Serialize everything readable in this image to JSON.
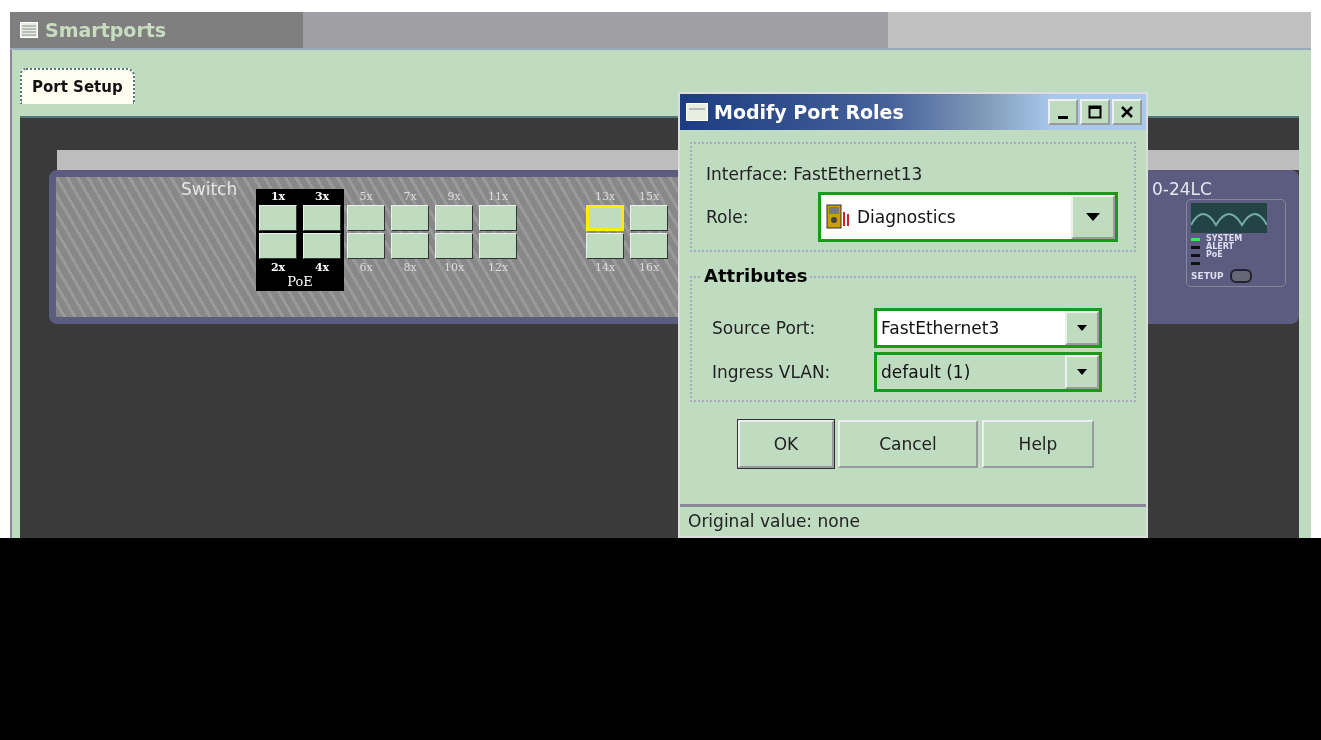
{
  "window": {
    "title": "Smartports"
  },
  "tabs": [
    {
      "label": "Port Setup",
      "selected": true
    }
  ],
  "switch": {
    "label": "Switch",
    "model": "0-24LC",
    "poe_label": "PoE",
    "port_groups": [
      [
        {
          "top": {
            "label": "1x",
            "selected": false
          },
          "bottom": {
            "label": "2x",
            "selected": false
          },
          "poe": true
        },
        {
          "top": {
            "label": "3x",
            "selected": false
          },
          "bottom": {
            "label": "4x",
            "selected": false
          },
          "poe": true
        },
        {
          "top": {
            "label": "5x",
            "selected": false
          },
          "bottom": {
            "label": "6x",
            "selected": false
          },
          "poe": false
        },
        {
          "top": {
            "label": "7x",
            "selected": false
          },
          "bottom": {
            "label": "8x",
            "selected": false
          },
          "poe": false
        },
        {
          "top": {
            "label": "9x",
            "selected": false
          },
          "bottom": {
            "label": "10x",
            "selected": false
          },
          "poe": false
        },
        {
          "top": {
            "label": "11x",
            "selected": false
          },
          "bottom": {
            "label": "12x",
            "selected": false
          },
          "poe": false
        }
      ],
      [
        {
          "top": {
            "label": "13x",
            "selected": true
          },
          "bottom": {
            "label": "14x",
            "selected": false
          },
          "poe": false
        },
        {
          "top": {
            "label": "15x",
            "selected": false
          },
          "bottom": {
            "label": "16x",
            "selected": false
          },
          "poe": false
        }
      ]
    ],
    "leds": [
      {
        "label": "SYSTEM",
        "on": true
      },
      {
        "label": "ALERT",
        "on": false
      },
      {
        "label": "PoE",
        "on": false
      },
      {
        "on": false
      }
    ],
    "setup_label": "SETUP"
  },
  "dialog": {
    "title": "Modify Port Roles",
    "interface": "Interface: FastEthernet13",
    "role": {
      "label": "Role:",
      "value": "Diagnostics"
    },
    "attributes": {
      "legend": "Attributes",
      "fields": [
        {
          "label": "Source Port:",
          "value": "FastEthernet3",
          "disabled": false
        },
        {
          "label": "Ingress VLAN:",
          "value": "default (1)",
          "disabled": true
        }
      ]
    },
    "buttons": [
      {
        "label": "OK",
        "default": true
      },
      {
        "label": "Cancel",
        "default": false
      },
      {
        "label": "Help",
        "default": false
      }
    ],
    "status": "Original value: none"
  }
}
